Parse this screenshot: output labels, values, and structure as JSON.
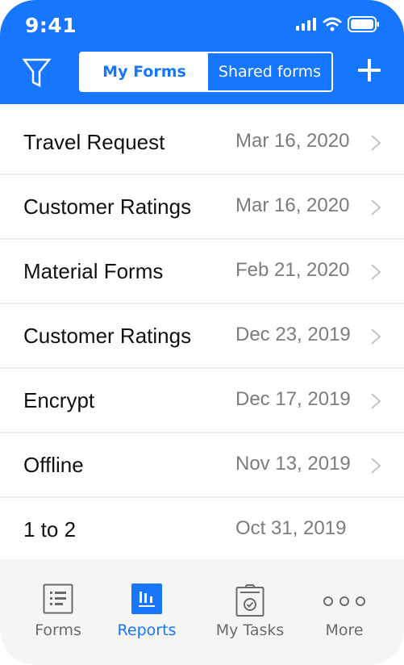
{
  "status_bar": {
    "time": "9:41",
    "icons": [
      "signal-icon",
      "wifi-icon",
      "battery-icon"
    ]
  },
  "header": {
    "filter_icon": "filter-icon",
    "add_icon": "plus-icon",
    "segments": [
      {
        "label": "My Forms",
        "active": true
      },
      {
        "label": "Shared forms",
        "active": false
      }
    ]
  },
  "forms": [
    {
      "name": "Travel Request",
      "date": "Mar 16, 2020",
      "has_chevron": true
    },
    {
      "name": "Customer Ratings",
      "date": "Mar 16, 2020",
      "has_chevron": true
    },
    {
      "name": "Material Forms",
      "date": "Feb 21, 2020",
      "has_chevron": true
    },
    {
      "name": "Customer Ratings",
      "date": "Dec 23, 2019",
      "has_chevron": true
    },
    {
      "name": "Encrypt",
      "date": "Dec 17, 2019",
      "has_chevron": true
    },
    {
      "name": "Offline",
      "date": "Nov 13, 2019",
      "has_chevron": true
    },
    {
      "name": "1 to 2",
      "date": "Oct 31, 2019",
      "has_chevron": false
    }
  ],
  "tab_bar": {
    "tabs": [
      {
        "label": "Forms",
        "icon": "list-icon",
        "active": false
      },
      {
        "label": "Reports",
        "icon": "bar-chart-icon",
        "active": true
      },
      {
        "label": "My Tasks",
        "icon": "clipboard-check-icon",
        "active": false
      },
      {
        "label": "More",
        "icon": "more-dots-icon",
        "active": false
      }
    ]
  },
  "colors": {
    "accent": "#1677fe",
    "tab_bar_bg": "#f5f5f4",
    "date_text": "#7c7c7c",
    "divider": "#eeeeee"
  }
}
